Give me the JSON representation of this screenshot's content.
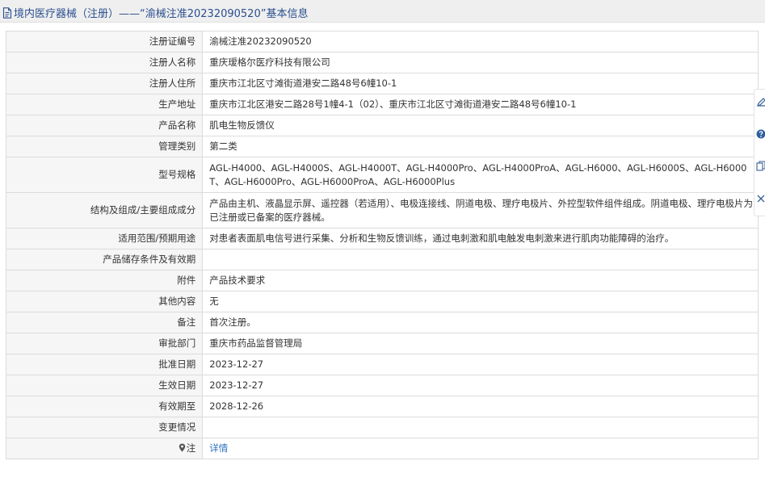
{
  "header": {
    "title": "境内医疗器械（注册）——“渝械注准20232090520”基本信息"
  },
  "rows": [
    {
      "label": "注册证编号",
      "value": "渝械注准20232090520"
    },
    {
      "label": "注册人名称",
      "value": "重庆瑷格尔医疗科技有限公司"
    },
    {
      "label": "注册人住所",
      "value": "重庆市江北区寸滩街道港安二路48号6幢10-1"
    },
    {
      "label": "生产地址",
      "value": "重庆市江北区港安二路28号1幢4-1（02）、重庆市江北区寸滩街道港安二路48号6幢10-1"
    },
    {
      "label": "产品名称",
      "value": "肌电生物反馈仪"
    },
    {
      "label": "管理类别",
      "value": "第二类"
    },
    {
      "label": "型号规格",
      "value": "AGL-H4000、AGL-H4000S、AGL-H4000T、AGL-H4000Pro、AGL-H4000ProA、AGL-H6000、AGL-H6000S、AGL-H6000T、AGL-H6000Pro、AGL-H6000ProA、AGL-H6000Plus"
    },
    {
      "label": "结构及组成/主要组成成分",
      "value": "产品由主机、液晶显示屏、遥控器（若适用）、电极连接线、阴道电极、理疗电极片、外控型软件组件组成。阴道电极、理疗电极片为已注册或已备案的医疗器械。"
    },
    {
      "label": "适用范围/预期用途",
      "value": "对患者表面肌电信号进行采集、分析和生物反馈训练，通过电刺激和肌电触发电刺激来进行肌肉功能障碍的治疗。"
    },
    {
      "label": "产品储存条件及有效期",
      "value": ""
    },
    {
      "label": "附件",
      "value": "产品技术要求"
    },
    {
      "label": "其他内容",
      "value": "无"
    },
    {
      "label": "备注",
      "value": "首次注册。"
    },
    {
      "label": "审批部门",
      "value": "重庆市药品监督管理局"
    },
    {
      "label": "批准日期",
      "value": "2023-12-27"
    },
    {
      "label": "生效日期",
      "value": "2023-12-27"
    },
    {
      "label": "有效期至",
      "value": "2028-12-26"
    },
    {
      "label": "变更情况",
      "value": ""
    }
  ],
  "note_row": {
    "label": "注",
    "link": "详情"
  },
  "colors": {
    "title": "#2a4f8f",
    "link": "#2a6fbf",
    "label_bg": "#f6f6f6",
    "border": "#dcdcdc"
  },
  "side_toolbar": {
    "icons": [
      "edit-icon",
      "help-icon",
      "copy-icon",
      "close-icon"
    ]
  }
}
